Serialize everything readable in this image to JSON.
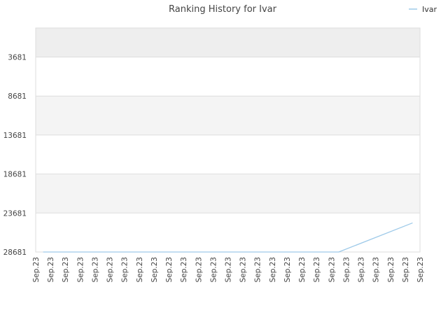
{
  "chart_data": {
    "type": "line",
    "title": "Ranking History for Ivar",
    "xlabel": "",
    "ylabel": "",
    "x": [
      "Sep.23",
      "Sep.23",
      "Sep.23",
      "Sep.23",
      "Sep.23",
      "Sep.23",
      "Sep.23",
      "Sep.23",
      "Sep.23",
      "Sep.23",
      "Sep.23",
      "Sep.23",
      "Sep.23",
      "Sep.23",
      "Sep.23",
      "Sep.23",
      "Sep.23",
      "Sep.23",
      "Sep.23",
      "Sep.23",
      "Sep.23",
      "Sep.23",
      "Sep.23",
      "Sep.23",
      "Sep.23",
      "Sep.23",
      "Sep.23"
    ],
    "y_ticks": [
      3681,
      8681,
      13681,
      18681,
      23681,
      28681
    ],
    "y_tick_labels": [
      "3681",
      "8681",
      "13681",
      "18681",
      "23681",
      "28681"
    ],
    "ylim": [
      28681,
      -49
    ],
    "y_inverted": true,
    "grid": true,
    "legend_position": "top-right",
    "series": [
      {
        "name": "Ivar",
        "color": "#9ecae9",
        "points": [
          {
            "x": 0.5,
            "y": 28681
          },
          {
            "x": 20.5,
            "y": 28681
          },
          {
            "x": 25.5,
            "y": 24950
          }
        ]
      }
    ]
  },
  "colors": {
    "band_dark": "#eeeeee",
    "band_mid": "#f4f4f4",
    "band_light": "#ffffff",
    "grid": "#dddddd"
  }
}
